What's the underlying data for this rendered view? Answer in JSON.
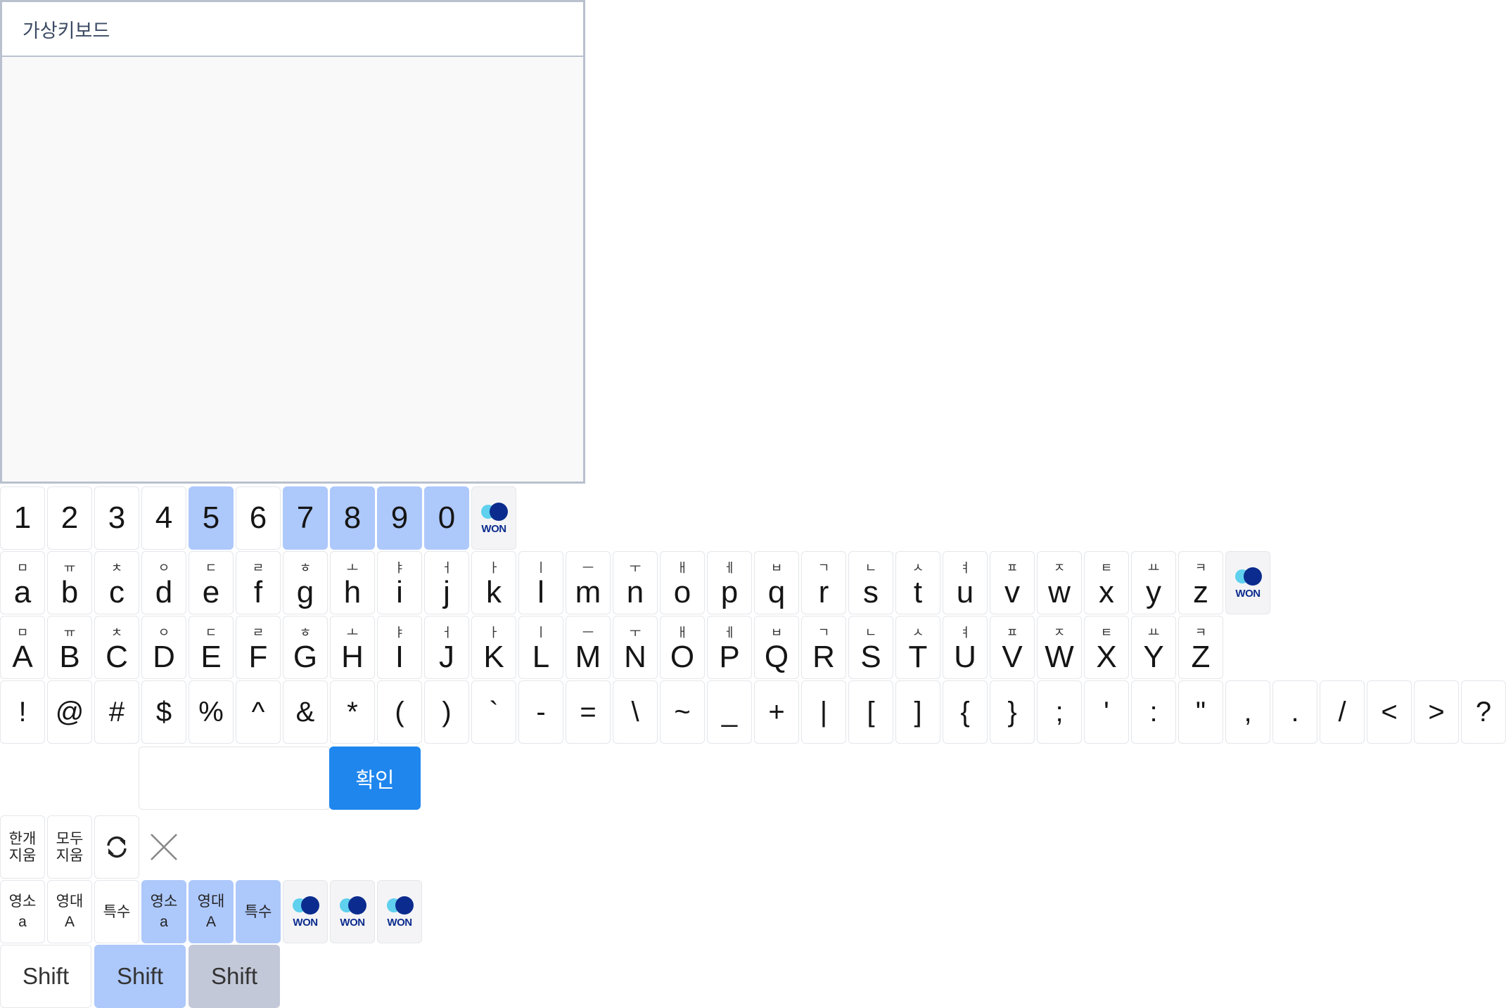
{
  "panel": {
    "title": "가상키보드"
  },
  "number_row": [
    {
      "label": "1",
      "selected": false
    },
    {
      "label": "2",
      "selected": false
    },
    {
      "label": "3",
      "selected": false
    },
    {
      "label": "4",
      "selected": false
    },
    {
      "label": "5",
      "selected": true
    },
    {
      "label": "6",
      "selected": false
    },
    {
      "label": "7",
      "selected": true
    },
    {
      "label": "8",
      "selected": true
    },
    {
      "label": "9",
      "selected": true
    },
    {
      "label": "0",
      "selected": true
    }
  ],
  "lower_row": [
    {
      "ko": "ㅁ",
      "en": "a"
    },
    {
      "ko": "ㅠ",
      "en": "b"
    },
    {
      "ko": "ㅊ",
      "en": "c"
    },
    {
      "ko": "ㅇ",
      "en": "d"
    },
    {
      "ko": "ㄷ",
      "en": "e"
    },
    {
      "ko": "ㄹ",
      "en": "f"
    },
    {
      "ko": "ㅎ",
      "en": "g"
    },
    {
      "ko": "ㅗ",
      "en": "h"
    },
    {
      "ko": "ㅑ",
      "en": "i"
    },
    {
      "ko": "ㅓ",
      "en": "j"
    },
    {
      "ko": "ㅏ",
      "en": "k"
    },
    {
      "ko": "ㅣ",
      "en": "l"
    },
    {
      "ko": "ㅡ",
      "en": "m"
    },
    {
      "ko": "ㅜ",
      "en": "n"
    },
    {
      "ko": "ㅐ",
      "en": "o"
    },
    {
      "ko": "ㅔ",
      "en": "p"
    },
    {
      "ko": "ㅂ",
      "en": "q"
    },
    {
      "ko": "ㄱ",
      "en": "r"
    },
    {
      "ko": "ㄴ",
      "en": "s"
    },
    {
      "ko": "ㅅ",
      "en": "t"
    },
    {
      "ko": "ㅕ",
      "en": "u"
    },
    {
      "ko": "ㅍ",
      "en": "v"
    },
    {
      "ko": "ㅈ",
      "en": "w"
    },
    {
      "ko": "ㅌ",
      "en": "x"
    },
    {
      "ko": "ㅛ",
      "en": "y"
    },
    {
      "ko": "ㅋ",
      "en": "z"
    }
  ],
  "upper_row": [
    {
      "ko": "ㅁ",
      "en": "A"
    },
    {
      "ko": "ㅠ",
      "en": "B"
    },
    {
      "ko": "ㅊ",
      "en": "C"
    },
    {
      "ko": "ㅇ",
      "en": "D"
    },
    {
      "ko": "ㄷ",
      "en": "E"
    },
    {
      "ko": "ㄹ",
      "en": "F"
    },
    {
      "ko": "ㅎ",
      "en": "G"
    },
    {
      "ko": "ㅗ",
      "en": "H"
    },
    {
      "ko": "ㅑ",
      "en": "I"
    },
    {
      "ko": "ㅓ",
      "en": "J"
    },
    {
      "ko": "ㅏ",
      "en": "K"
    },
    {
      "ko": "ㅣ",
      "en": "L"
    },
    {
      "ko": "ㅡ",
      "en": "M"
    },
    {
      "ko": "ㅜ",
      "en": "N"
    },
    {
      "ko": "ㅐ",
      "en": "O"
    },
    {
      "ko": "ㅔ",
      "en": "P"
    },
    {
      "ko": "ㅂ",
      "en": "Q"
    },
    {
      "ko": "ㄱ",
      "en": "R"
    },
    {
      "ko": "ㄴ",
      "en": "S"
    },
    {
      "ko": "ㅅ",
      "en": "T"
    },
    {
      "ko": "ㅕ",
      "en": "U"
    },
    {
      "ko": "ㅍ",
      "en": "V"
    },
    {
      "ko": "ㅈ",
      "en": "W"
    },
    {
      "ko": "ㅌ",
      "en": "X"
    },
    {
      "ko": "ㅛ",
      "en": "Y"
    },
    {
      "ko": "ㅋ",
      "en": "Z"
    }
  ],
  "symbol_row": [
    "!",
    "@",
    "#",
    "$",
    "%",
    "^",
    "&",
    "*",
    "(",
    ")",
    "`",
    "-",
    "=",
    "\\",
    "~",
    "_",
    "+",
    "|",
    "[",
    "]",
    "{",
    "}",
    ";",
    "'",
    ":",
    "\"",
    ",",
    ".",
    "/",
    "<",
    ">",
    "?"
  ],
  "won_label": "WON",
  "confirm": {
    "label": "확인"
  },
  "edit_keys": {
    "delete_one": [
      "한개",
      "지움"
    ],
    "delete_all": [
      "모두",
      "지움"
    ]
  },
  "mode_keys": [
    {
      "top": "영소",
      "bottom": "a",
      "selected": false
    },
    {
      "top": "영대",
      "bottom": "A",
      "selected": false
    },
    {
      "top": "특수",
      "bottom": "",
      "selected": false
    },
    {
      "top": "영소",
      "bottom": "a",
      "selected": true
    },
    {
      "top": "영대",
      "bottom": "A",
      "selected": true
    },
    {
      "top": "특수",
      "bottom": "",
      "selected": true
    }
  ],
  "shift_keys": [
    {
      "label": "Shift",
      "state": "normal"
    },
    {
      "label": "Shift",
      "state": "active"
    },
    {
      "label": "Shift",
      "state": "pressed"
    }
  ],
  "colors": {
    "selected_key": "#adc8fb",
    "confirm_button": "#1f86ee",
    "pressed_key": "#c3c8d8",
    "panel_border": "#b9c0ce",
    "won_dark": "#0b2c8e",
    "won_light": "#5fd0ee"
  }
}
